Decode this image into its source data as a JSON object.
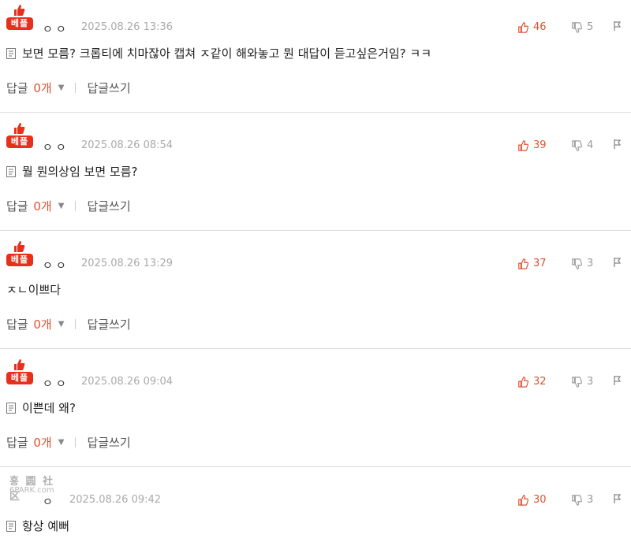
{
  "badge_label": "베플",
  "actions": {
    "reply_label": "답글",
    "reply_count": "0개",
    "write_label": "답글쓰기"
  },
  "watermark": {
    "line1": "홍 圆 社 区",
    "line2": "6PARK.com"
  },
  "comments": [
    {
      "nick": "ㅇㅇ",
      "date": "2025.08.26 13:36",
      "likes": "46",
      "dislikes": "5",
      "text": "보면 모름? 크롭티에 치마잖아 캡쳐 ㅈ같이 해와놓고 뭔 대답이 듣고싶은거임? ㅋㅋ",
      "has_image": true
    },
    {
      "nick": "ㅇㅇ",
      "date": "2025.08.26 08:54",
      "likes": "39",
      "dislikes": "4",
      "text": "뭘 뭔의상임 보면 모름?",
      "has_image": true
    },
    {
      "nick": "ㅇㅇ",
      "date": "2025.08.26 13:29",
      "likes": "37",
      "dislikes": "3",
      "text": "ㅈㄴ이쁘다",
      "has_image": false
    },
    {
      "nick": "ㅇㅇ",
      "date": "2025.08.26 09:04",
      "likes": "32",
      "dislikes": "3",
      "text": "이쁜데 왜?",
      "has_image": true
    },
    {
      "nick": "ㅇ",
      "date": "2025.08.26 09:42",
      "likes": "30",
      "dislikes": "3",
      "text": "항상 예뻐",
      "has_image": true
    }
  ],
  "colors": {
    "accent": "#e05030",
    "badge": "#e6301c",
    "muted": "#aaaaaa"
  }
}
